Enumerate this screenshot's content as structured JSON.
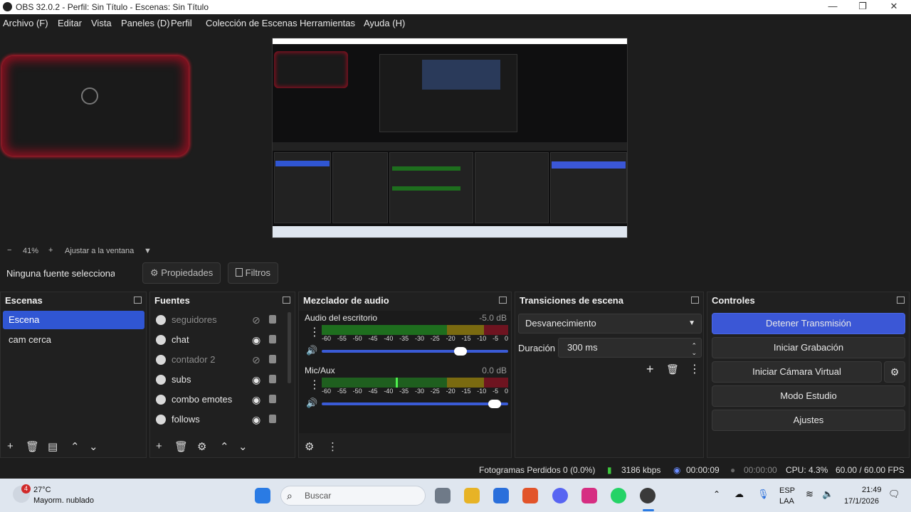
{
  "window": {
    "title": "OBS 32.0.2 - Perfil: Sin Título - Escenas: Sin Título",
    "minimize": "—",
    "maximize": "❐",
    "close": "✕"
  },
  "menu": [
    "Archivo (F)",
    "Editar",
    "Vista",
    "Paneles (D)",
    "Perfil",
    "Colección de Escenas",
    "Herramientas",
    "Ayuda (H)"
  ],
  "zoom": {
    "minus": "−",
    "value": "41%",
    "plus": "+",
    "fit": "Ajustar a la ventana",
    "caret": "▼"
  },
  "source_toolbar": {
    "no_source": "Ninguna fuente seleccionada",
    "properties": "Propiedades",
    "filters": "Filtros"
  },
  "scenes": {
    "title": "Escenas",
    "items": [
      "Escena",
      "cam cerca"
    ],
    "selected": 0
  },
  "sources": {
    "title": "Fuentes",
    "items": [
      {
        "label": "seguidores",
        "visible": false
      },
      {
        "label": "chat",
        "visible": true
      },
      {
        "label": "contador 2",
        "visible": false
      },
      {
        "label": "subs",
        "visible": true
      },
      {
        "label": "combo emotes",
        "visible": true
      },
      {
        "label": "follows",
        "visible": true
      }
    ]
  },
  "mixer": {
    "title": "Mezclador de audio",
    "ticks": [
      "-60",
      "-55",
      "-50",
      "-45",
      "-40",
      "-35",
      "-30",
      "-25",
      "-20",
      "-15",
      "-10",
      "-5",
      "0"
    ],
    "channels": [
      {
        "name": "Audio del escritorio",
        "db": "-5.0 dB",
        "level": 0.78
      },
      {
        "name": "Mic/Aux",
        "db": "0.0 dB",
        "level": 0.96
      }
    ]
  },
  "transitions": {
    "title": "Transiciones de escena",
    "selected": "Desvanecimiento",
    "duration_label": "Duración",
    "duration_value": "300 ms"
  },
  "controls": {
    "title": "Controles",
    "stop_stream": "Detener Transmisión",
    "start_record": "Iniciar Grabación",
    "start_virtualcam": "Iniciar Cámara Virtual",
    "studio_mode": "Modo Estudio",
    "settings": "Ajustes"
  },
  "status": {
    "dropped": "Fotogramas Perdidos 0 (0.0%)",
    "bitrate": "3186 kbps",
    "stream_time": "00:00:09",
    "rec_time": "00:00:00",
    "cpu": "CPU: 4.3%",
    "fps": "60.00 / 60.00 FPS"
  },
  "taskbar": {
    "weather_temp": "27°C",
    "weather_desc": "Mayorm. nublado",
    "weather_badge": "4",
    "search": "Buscar",
    "lang_top": "ESP",
    "lang_bottom": "LAA",
    "time": "21:49",
    "date": "17/1/2026"
  }
}
